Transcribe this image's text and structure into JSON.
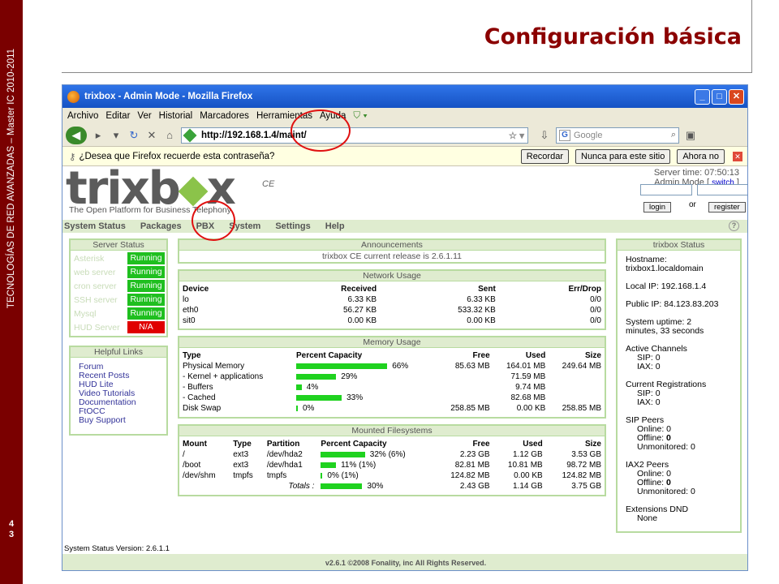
{
  "slide": {
    "title": "Configuración básica",
    "side_text": "TECNOLOGÍAS DE RED AVANZADAS – Master IC 2010-2011",
    "page_number": "4\n3",
    "colors": {
      "sidebar": "#7a0000",
      "title": "#8b0000",
      "annotation": "#e01010"
    }
  },
  "browser": {
    "window_title": "trixbox - Admin Mode - Mozilla Firefox",
    "menu": [
      "Archivo",
      "Editar",
      "Ver",
      "Historial",
      "Marcadores",
      "Herramientas",
      "Ayuda"
    ],
    "url": "http://192.168.1.4/maint/",
    "search_placeholder": "Google",
    "password_prompt": {
      "text": "¿Desea que Firefox recuerde esta contraseña?",
      "remember": "Recordar",
      "never": "Nunca para este sitio",
      "not_now": "Ahora no"
    }
  },
  "trixbox": {
    "logo": {
      "left": "trixb",
      "right": "x",
      "edition": "CE"
    },
    "slogan": "The Open Platform for Business Telephony",
    "server_time": "Server time: 07:50:13",
    "mode": "Admin Mode",
    "switch_link": "switch",
    "login_btn": "login",
    "or_text": "or",
    "register_btn": "register",
    "nav": [
      "System Status",
      "Packages",
      "PBX",
      "System",
      "Settings",
      "Help"
    ],
    "server_status": {
      "title": "Server Status",
      "items": [
        {
          "name": "Asterisk",
          "status": "Running"
        },
        {
          "name": "web server",
          "status": "Running"
        },
        {
          "name": "cron server",
          "status": "Running"
        },
        {
          "name": "SSH server",
          "status": "Running"
        },
        {
          "name": "Mysql",
          "status": "Running"
        },
        {
          "name": "HUD Server",
          "status": "N/A"
        }
      ]
    },
    "helpful_links": {
      "title": "Helpful Links",
      "items": [
        "Forum",
        "Recent Posts",
        "HUD Lite",
        "Video Tutorials",
        "Documentation",
        "FtOCC",
        "Buy Support"
      ]
    },
    "announcements": {
      "title": "Announcements",
      "text": "trixbox CE current release is 2.6.1.11"
    },
    "network": {
      "title": "Network Usage",
      "headers": [
        "Device",
        "Received",
        "Sent",
        "Err/Drop"
      ],
      "rows": [
        [
          "lo",
          "6.33 KB",
          "6.33 KB",
          "0/0"
        ],
        [
          "eth0",
          "56.27 KB",
          "533.32 KB",
          "0/0"
        ],
        [
          "sit0",
          "0.00 KB",
          "0.00 KB",
          "0/0"
        ]
      ]
    },
    "memory": {
      "title": "Memory Usage",
      "headers": [
        "Type",
        "Percent Capacity",
        "Free",
        "Used",
        "Size"
      ],
      "rows": [
        {
          "type": "Physical Memory",
          "pct": 66,
          "pct_label": "66%",
          "free": "85.63 MB",
          "used": "164.01 MB",
          "size": "249.64 MB"
        },
        {
          "type": "- Kernel + applications",
          "pct": 29,
          "pct_label": "29%",
          "free": "",
          "used": "71.59 MB",
          "size": ""
        },
        {
          "type": "- Buffers",
          "pct": 4,
          "pct_label": "4%",
          "free": "",
          "used": "9.74 MB",
          "size": ""
        },
        {
          "type": "- Cached",
          "pct": 33,
          "pct_label": "33%",
          "free": "",
          "used": "82.68 MB",
          "size": ""
        },
        {
          "type": "Disk Swap",
          "pct": 0,
          "pct_label": "0%",
          "free": "258.85 MB",
          "used": "0.00 KB",
          "size": "258.85 MB"
        }
      ]
    },
    "filesystems": {
      "title": "Mounted Filesystems",
      "headers": [
        "Mount",
        "Type",
        "Partition",
        "Percent Capacity",
        "Free",
        "Used",
        "Size"
      ],
      "rows": [
        {
          "mount": "/",
          "type": "ext3",
          "partition": "/dev/hda2",
          "pct": 32,
          "pct_label": "32% (6%)",
          "free": "2.23 GB",
          "used": "1.12 GB",
          "size": "3.53 GB"
        },
        {
          "mount": "/boot",
          "type": "ext3",
          "partition": "/dev/hda1",
          "pct": 11,
          "pct_label": "11% (1%)",
          "free": "82.81 MB",
          "used": "10.81 MB",
          "size": "98.72 MB"
        },
        {
          "mount": "/dev/shm",
          "type": "tmpfs",
          "partition": "tmpfs",
          "pct": 0,
          "pct_label": "0% (1%)",
          "free": "124.82 MB",
          "used": "0.00 KB",
          "size": "124.82 MB"
        }
      ],
      "totals": {
        "label": "Totals :",
        "pct": 30,
        "pct_label": "30%",
        "free": "2.43 GB",
        "used": "1.14 GB",
        "size": "3.75 GB"
      }
    },
    "status": {
      "title": "trixbox Status",
      "hostname_label": "Hostname:",
      "hostname": "trixbox1.localdomain",
      "local_ip": "Local IP: 192.168.1.4",
      "public_ip": "Public IP: 84.123.83.203",
      "uptime_1": "System uptime: 2",
      "uptime_2": "minutes, 33 seconds",
      "active_channels": "Active Channels",
      "ac_sip": "SIP: 0",
      "ac_iax": "IAX: 0",
      "registrations": "Current Registrations",
      "reg_sip": "SIP: 0",
      "reg_iax": "IAX: 0",
      "sip_peers": "SIP Peers",
      "sip_online": "Online: 0",
      "sip_offline_label": "Offline: ",
      "sip_offline_value": "0",
      "sip_unmon": "Unmonitored: 0",
      "iax_peers": "IAX2 Peers",
      "iax_online": "Online: 0",
      "iax_offline_label": "Offline: ",
      "iax_offline_value": "0",
      "iax_unmon": "Unmonitored: 0",
      "ext_dnd": "Extensions DND",
      "ext_dnd_value": "None"
    },
    "version": "System Status Version: 2.6.1.1",
    "footer": "v2.6.1 ©2008 Fonality, inc All Rights Reserved."
  }
}
